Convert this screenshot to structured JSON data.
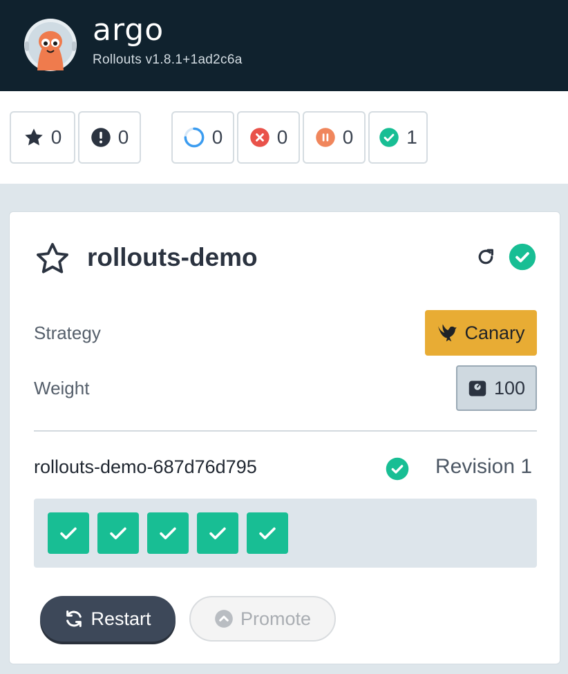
{
  "app": {
    "brand": "argo",
    "version": "Rollouts v1.8.1+1ad2c6a"
  },
  "filters": [
    {
      "icon": "star-icon",
      "count": "0"
    },
    {
      "icon": "exclamation-icon",
      "count": "0"
    },
    {
      "icon": "progressing-icon",
      "count": "0"
    },
    {
      "icon": "degraded-icon",
      "count": "0"
    },
    {
      "icon": "paused-icon",
      "count": "0"
    },
    {
      "icon": "healthy-icon",
      "count": "1"
    }
  ],
  "rollout": {
    "name": "rollouts-demo",
    "strategy_label": "Strategy",
    "strategy_value": "Canary",
    "weight_label": "Weight",
    "weight_value": "100",
    "replicaset": {
      "name": "rollouts-demo-687d76d795",
      "revision": "Revision 1",
      "pods": [
        "healthy",
        "healthy",
        "healthy",
        "healthy",
        "healthy"
      ]
    },
    "actions": {
      "restart": "Restart",
      "promote": "Promote"
    }
  },
  "colors": {
    "header_bg": "#10222e",
    "healthy": "#18be94",
    "degraded": "#e9524a",
    "paused": "#f0865c",
    "progressing": "#3b9cf0",
    "canary": "#e8ac34"
  }
}
